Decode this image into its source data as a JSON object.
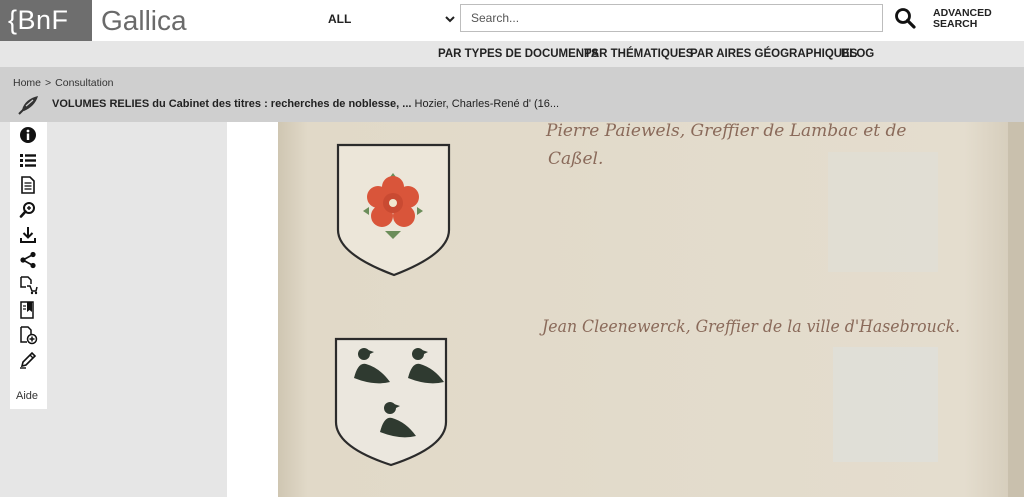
{
  "header": {
    "logo_bnf": "{BnF",
    "logo_gallica": "Gallica",
    "scope_label": "ALL",
    "search_placeholder": "Search...",
    "advanced_line1": "ADVANCED",
    "advanced_line2": "SEARCH"
  },
  "nav": {
    "items": [
      {
        "label": "PAR TYPES DE DOCUMENTS"
      },
      {
        "label": "PAR THÉMATIQUES"
      },
      {
        "label": "PAR AIRES GÉOGRAPHIQUES"
      },
      {
        "label": "BLOG"
      }
    ]
  },
  "breadcrumb": {
    "home": "Home",
    "separator": ">",
    "current": "Consultation"
  },
  "document": {
    "title_bold": "VOLUMES RELIES du Cabinet des titres : recherches de noblesse, ...",
    "author": "Hozier, Charles-René d' (16..."
  },
  "sidebar": {
    "icons": [
      "info-icon",
      "list-icon",
      "document-icon",
      "zoom-icon",
      "download-icon",
      "share-icon",
      "cart-icon",
      "bookmark-icon",
      "add-document-icon",
      "pencil-icon"
    ],
    "help_label": "Aide"
  },
  "page_text": {
    "line1": "Pierre Paiewels, Greffier de Lambac et de",
    "line2": "Caßel.",
    "line3": "Jean Cleenewerck, Greffier de la ville d'Hasebrouck."
  },
  "colors": {
    "logo_bg": "#6e6e6e",
    "nav_bg": "#e6e6e6",
    "crumb_bg": "#cfcfcf",
    "parchment": "#e3dccd",
    "rose": "#d9553a"
  }
}
